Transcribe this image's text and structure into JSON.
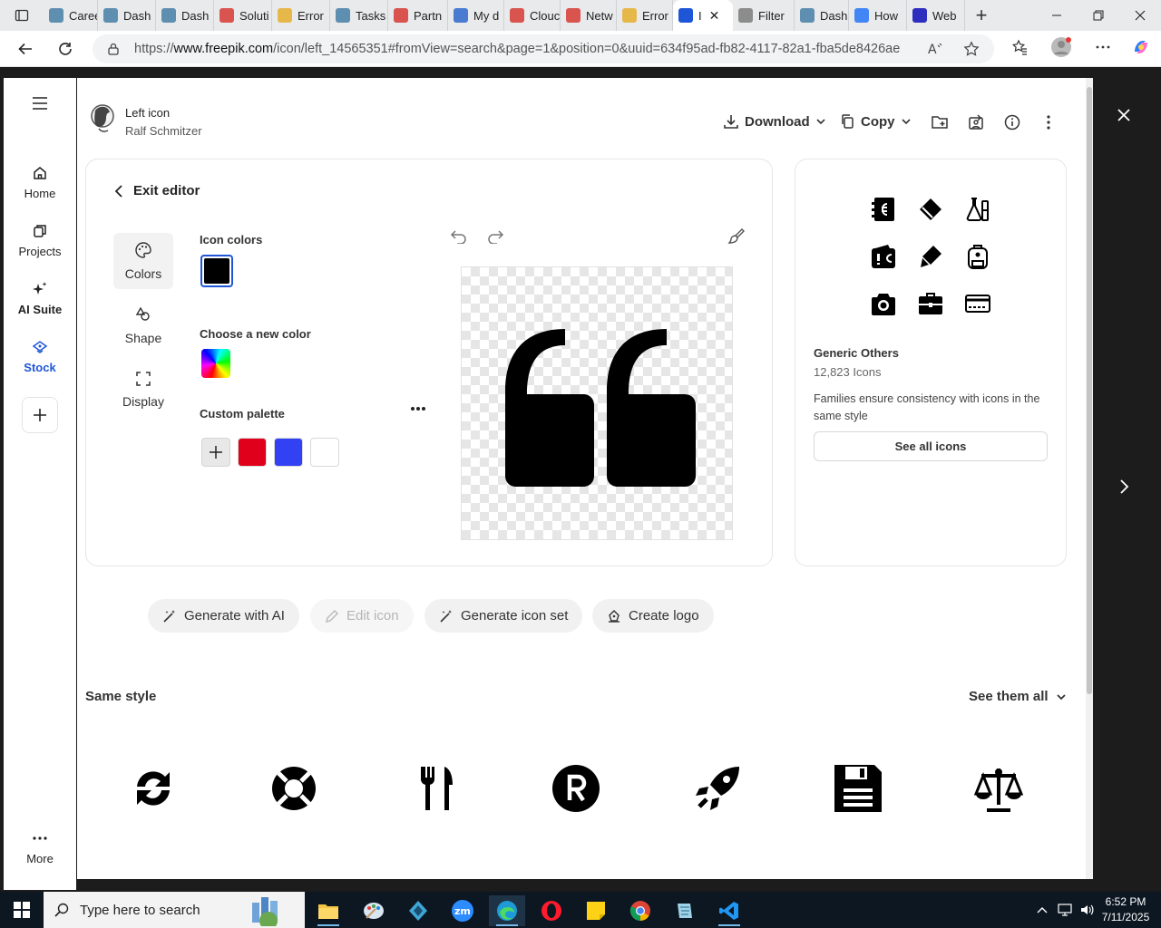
{
  "browser": {
    "tabs": [
      {
        "title": "Caree",
        "color": "#5f8fb0"
      },
      {
        "title": "Dash",
        "color": "#5f8fb0"
      },
      {
        "title": "Dash",
        "color": "#5f8fb0"
      },
      {
        "title": "Soluti",
        "color": "#d9534f"
      },
      {
        "title": "Error",
        "color": "#e6b84a"
      },
      {
        "title": "Tasks",
        "color": "#5f8fb0"
      },
      {
        "title": "Partn",
        "color": "#d9534f"
      },
      {
        "title": "My d",
        "color": "#4a7bd0"
      },
      {
        "title": "Clouc",
        "color": "#d9534f"
      },
      {
        "title": "Netw",
        "color": "#d9534f"
      },
      {
        "title": "Error",
        "color": "#e6b84a"
      },
      {
        "title": "I",
        "color": "#1f56d8"
      },
      {
        "title": "Filter",
        "color": "#8c8c8c"
      },
      {
        "title": "Dash",
        "color": "#5f8fb0"
      },
      {
        "title": "How",
        "color": "#4285f4"
      },
      {
        "title": "Web",
        "color": "#2f2fbf"
      }
    ],
    "url_prefix": "https://",
    "url_host": "www.freepik.com",
    "url_path": "/icon/left_14565351#fromView=search&page=1&position=0&uuid=634f95ad-fb82-4117-82a1-fba5de8426ae"
  },
  "rail": {
    "items": [
      {
        "label": "Home",
        "icon": "home-icon"
      },
      {
        "label": "Projects",
        "icon": "projects-icon"
      },
      {
        "label": "AI Suite",
        "icon": "sparkle-icon"
      },
      {
        "label": "Stock",
        "icon": "stock-icon"
      }
    ],
    "more_label": "More"
  },
  "header": {
    "icon_title": "Left icon",
    "author": "Ralf Schmitzer",
    "download_label": "Download",
    "copy_label": "Copy"
  },
  "editor": {
    "exit_label": "Exit editor",
    "tabs": {
      "colors": "Colors",
      "shape": "Shape",
      "display": "Display"
    },
    "icon_colors_label": "Icon colors",
    "choose_color_label": "Choose a new color",
    "custom_palette_label": "Custom palette",
    "current_color": "#000000",
    "palette": [
      "#e0001b",
      "#3341f5",
      "#ffffff"
    ]
  },
  "family": {
    "name": "Generic Others",
    "count": "12,823 Icons",
    "description": "Families ensure consistency with icons in the same style",
    "see_all_label": "See all icons"
  },
  "actions": {
    "generate_ai": "Generate with AI",
    "edit_icon": "Edit icon",
    "generate_set": "Generate icon set",
    "create_logo": "Create logo"
  },
  "same_style": {
    "title": "Same style",
    "see_all": "See them all"
  },
  "taskbar": {
    "search_placeholder": "Type here to search",
    "time": "6:52 PM",
    "date": "7/11/2025"
  }
}
